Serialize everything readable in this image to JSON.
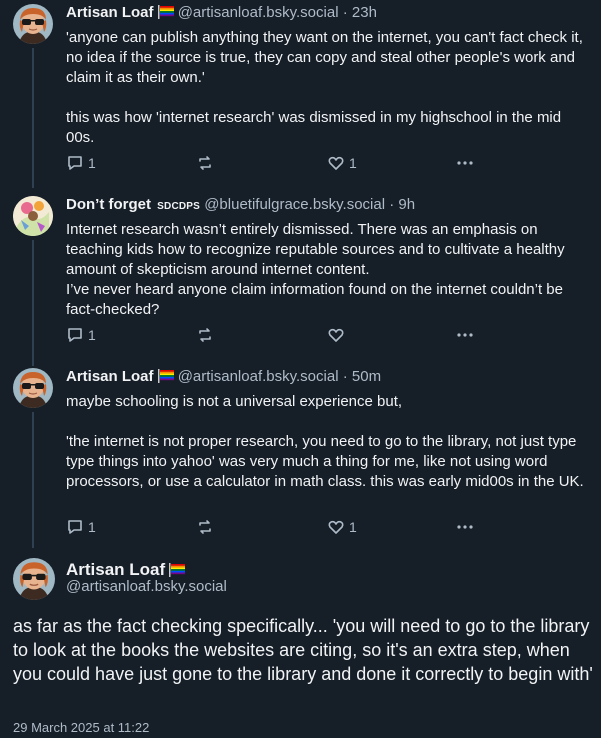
{
  "posts": [
    {
      "name": "Artisan Loaf",
      "handle": "@artisanloaf.bsky.social",
      "time": "23h",
      "body": [
        "'anyone can publish anything they want on the internet, you can't fact check it, no idea if the source is true, they can copy and steal other people's work and claim it as their own.'",
        "this was how 'internet research' was dismissed in my highschool in the mid 00s."
      ],
      "replies": "1",
      "reposts": "",
      "likes": "1"
    },
    {
      "name": "Don’t forget",
      "badge": "SDCDPS",
      "handle": "@bluetifulgrace.bsky.social",
      "time": "9h",
      "body": [
        "Internet research wasn’t entirely dismissed. There was an emphasis on teaching kids how to recognize reputable sources and to cultivate a healthy amount of skepticism around internet content.",
        "I’ve never heard anyone claim information found on the internet couldn’t be fact-checked?"
      ],
      "replies": "1",
      "reposts": "",
      "likes": ""
    },
    {
      "name": "Artisan Loaf",
      "handle": "@artisanloaf.bsky.social",
      "time": "50m",
      "body": [
        "maybe schooling is not a universal experience but,",
        "'the internet is not proper research, you need to go to the library, not just type type things into yahoo' was very much a thing for me, like not using word processors, or use a calculator in math class. this was early mid00s in the UK."
      ],
      "replies": "1",
      "reposts": "",
      "likes": "1"
    }
  ],
  "main": {
    "name": "Artisan Loaf",
    "handle": "@artisanloaf.bsky.social",
    "body": "as far as the fact checking specifically... 'you will need to go to the library to look at the books the websites are citing, so it's an extra step, when you could have just gone to the library and done it correctly to begin with'",
    "timestamp": "29 March 2025 at 11:22"
  },
  "separator": "·",
  "colors": {
    "background": "#161e27",
    "text": "#f1f3f5",
    "muted": "#aebbc9",
    "thread_line": "#2e4052"
  }
}
